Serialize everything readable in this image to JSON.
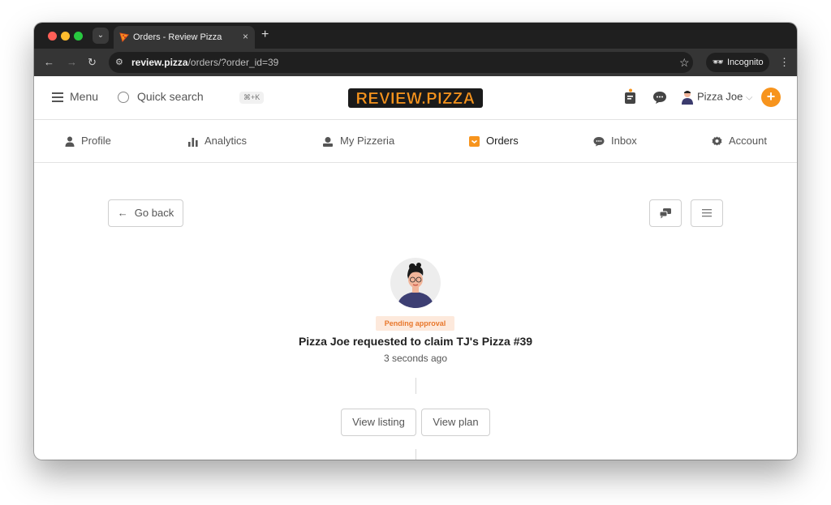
{
  "browser": {
    "tab_title": "Orders - Review Pizza",
    "tab_close": "×",
    "new_tab": "+",
    "url_host": "review.pizza",
    "url_path": "/orders/?order_id=39",
    "incognito_label": "Incognito",
    "icons": [
      "back-icon",
      "forward-icon",
      "reload-icon",
      "site-settings-icon",
      "star-icon",
      "incognito-icon",
      "kebab-icon"
    ]
  },
  "header": {
    "menu_label": "Menu",
    "search_label": "Quick search",
    "search_shortcut": "⌘+K",
    "logo_text": "REVIEW.PIZZA",
    "user_name": "Pizza Joe",
    "user_caret": "⌵",
    "plus_label": "+"
  },
  "nav": {
    "tabs": [
      {
        "label": "Profile",
        "icon": "person-icon"
      },
      {
        "label": "Analytics",
        "icon": "bar-chart-icon"
      },
      {
        "label": "My Pizzeria",
        "icon": "store-icon"
      },
      {
        "label": "Orders",
        "icon": "orders-icon",
        "active": true
      },
      {
        "label": "Inbox",
        "icon": "chat-icon"
      },
      {
        "label": "Account",
        "icon": "gear-icon"
      }
    ]
  },
  "content": {
    "back_label": "Go back",
    "status_badge": "Pending approval",
    "headline": "Pizza Joe requested to claim TJ's Pizza #39",
    "timestamp": "3 seconds ago",
    "view_listing_label": "View listing",
    "view_plan_label": "View plan"
  },
  "colors": {
    "accent": "#f7941d",
    "badge_bg": "#fde9dc",
    "badge_text": "#e8772b",
    "browser_dark": "#1f1f1f",
    "browser_mid": "#353535"
  }
}
